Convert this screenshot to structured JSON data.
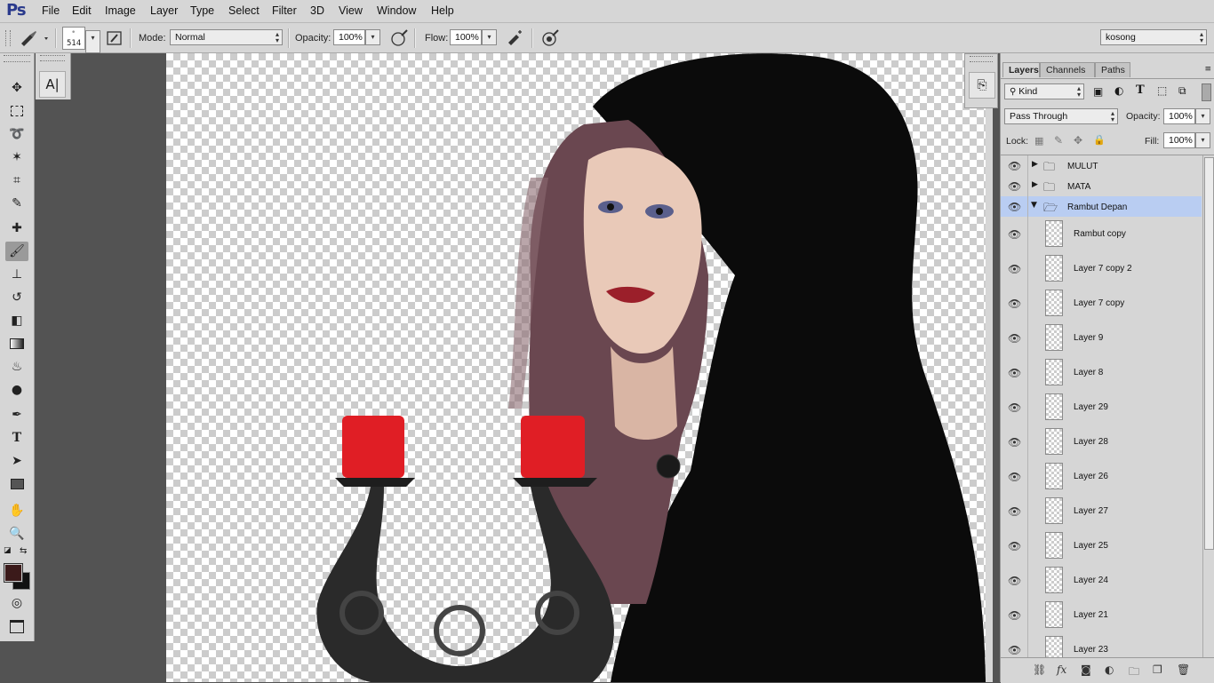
{
  "app": {
    "logo": "Ps"
  },
  "menu": [
    "File",
    "Edit",
    "Image",
    "Layer",
    "Type",
    "Select",
    "Filter",
    "3D",
    "View",
    "Window",
    "Help"
  ],
  "options": {
    "brush_size": "514",
    "mode_label": "Mode:",
    "mode_value": "Normal",
    "opacity_label": "Opacity:",
    "opacity_value": "100%",
    "flow_label": "Flow:",
    "flow_value": "100%",
    "preset_value": "kosong"
  },
  "colors": {
    "foreground": "#3b1a1a",
    "background": "#111111",
    "selection": "#b9cdf2"
  },
  "layers_panel": {
    "tabs": [
      "Layers",
      "Channels",
      "Paths"
    ],
    "filter_label": "Kind",
    "blend_mode": "Pass Through",
    "opacity_label": "Opacity:",
    "opacity_value": "100%",
    "lock_label": "Lock:",
    "fill_label": "Fill:",
    "fill_value": "100%",
    "groups": [
      {
        "name": "MULUT",
        "expanded": false
      },
      {
        "name": "MATA",
        "expanded": false
      },
      {
        "name": "Rambut Depan",
        "expanded": true
      }
    ],
    "layers": [
      "Rambut copy",
      "Layer 7 copy 2",
      "Layer 7 copy",
      "Layer 9",
      "Layer 8",
      "Layer 29",
      "Layer 28",
      "Layer 26",
      "Layer 27",
      "Layer 25",
      "Layer 24",
      "Layer 21",
      "Layer 23"
    ]
  },
  "icons": {
    "footer": [
      "link-icon",
      "fx-icon",
      "mask-icon",
      "adjustment-icon",
      "folder-icon",
      "new-layer-icon",
      "trash-icon"
    ]
  }
}
